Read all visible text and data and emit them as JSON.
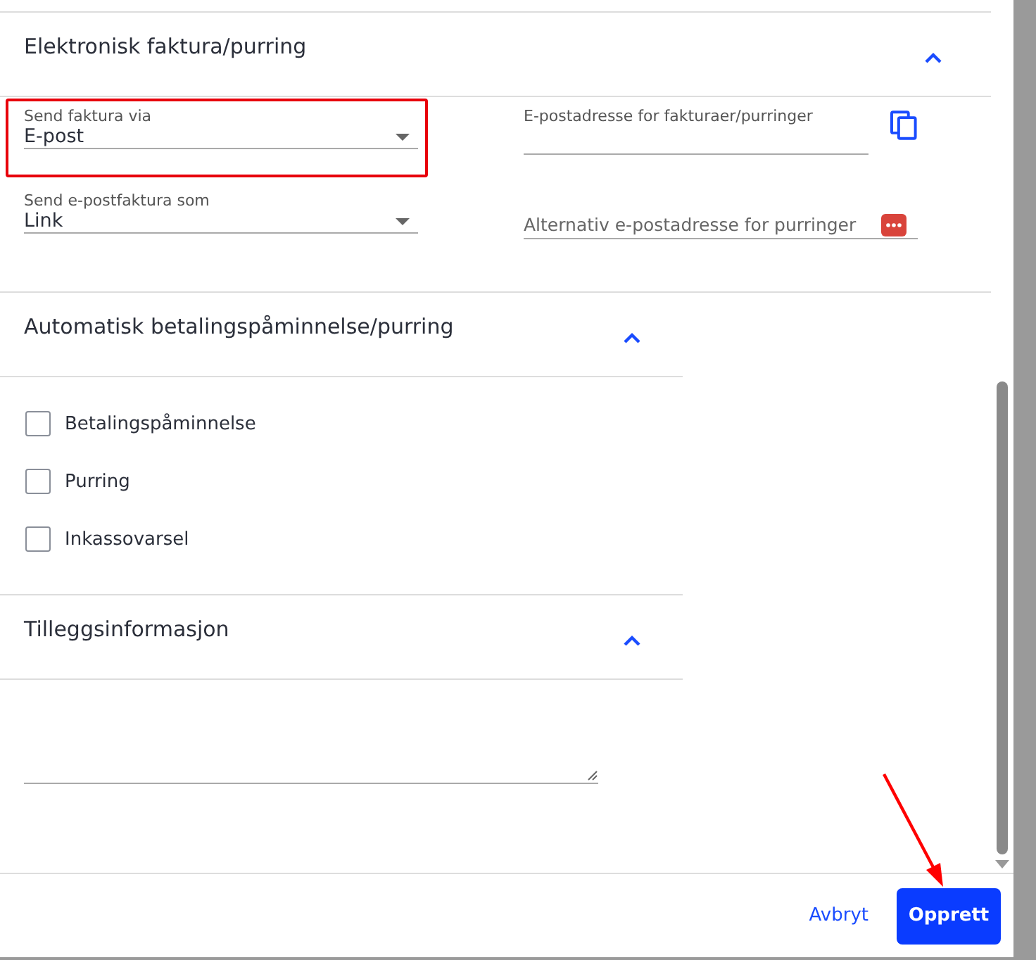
{
  "sections": [
    {
      "kind": "fields",
      "title": "Elektronisk faktura/purring",
      "expanded": true,
      "fields": [
        {
          "kind": "select",
          "label": "Send faktura via",
          "value": "E-post",
          "highlighted": true
        },
        {
          "kind": "copy-field",
          "label": "E-postadresse for fakturaer/purringer"
        },
        {
          "kind": "select",
          "label": "Send e-postfaktura som",
          "value": "Link",
          "highlighted": false
        },
        {
          "kind": "menu-field",
          "placeholder": "Alternativ e-postadresse for purringer"
        }
      ]
    },
    {
      "kind": "checkboxes",
      "title": "Automatisk betalingspåminnelse/purring",
      "expanded": true,
      "checkboxes": [
        {
          "label": "Betalingspåminnelse",
          "checked": false
        },
        {
          "label": "Purring",
          "checked": false
        },
        {
          "label": "Inkassovarsel",
          "checked": false
        }
      ]
    },
    {
      "kind": "notes",
      "title": "Tilleggsinformasjon",
      "expanded": true
    }
  ],
  "footer": {
    "cancel": "Avbryt",
    "submit": "Opprett"
  }
}
